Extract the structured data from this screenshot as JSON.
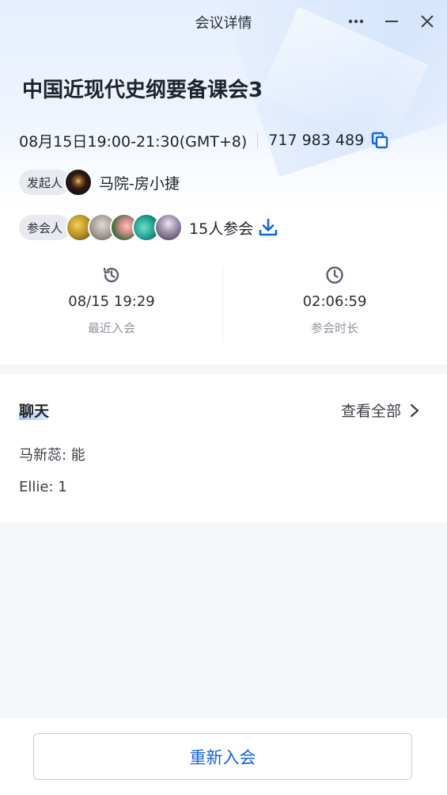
{
  "window": {
    "title": "会议详情"
  },
  "meeting": {
    "title": "中国近现代史纲要备课会3",
    "time": "08月15日19:00-21:30(GMT+8)",
    "id": "717 983 489"
  },
  "host": {
    "tag": "发起人",
    "name": "马院-房小捷"
  },
  "attendees": {
    "tag": "参会人",
    "count_text": "15人参会"
  },
  "stats": {
    "last_join": {
      "value": "08/15 19:29",
      "label": "最近入会"
    },
    "duration": {
      "value": "02:06:59",
      "label": "参会时长"
    }
  },
  "chat": {
    "title": "聊天",
    "view_all": "查看全部",
    "messages": [
      {
        "text": "马新蕊: 能"
      },
      {
        "text": "Ellie: 1"
      }
    ]
  },
  "footer": {
    "rejoin_label": "重新入会"
  },
  "colors": {
    "accent": "#1764e0",
    "muted": "#8f959e",
    "icon_gray": "#5b6270"
  },
  "icons": [
    "more-icon",
    "minimize-icon",
    "close-icon",
    "copy-icon",
    "download-icon",
    "history-icon",
    "clock-icon",
    "chevron-right-icon"
  ]
}
